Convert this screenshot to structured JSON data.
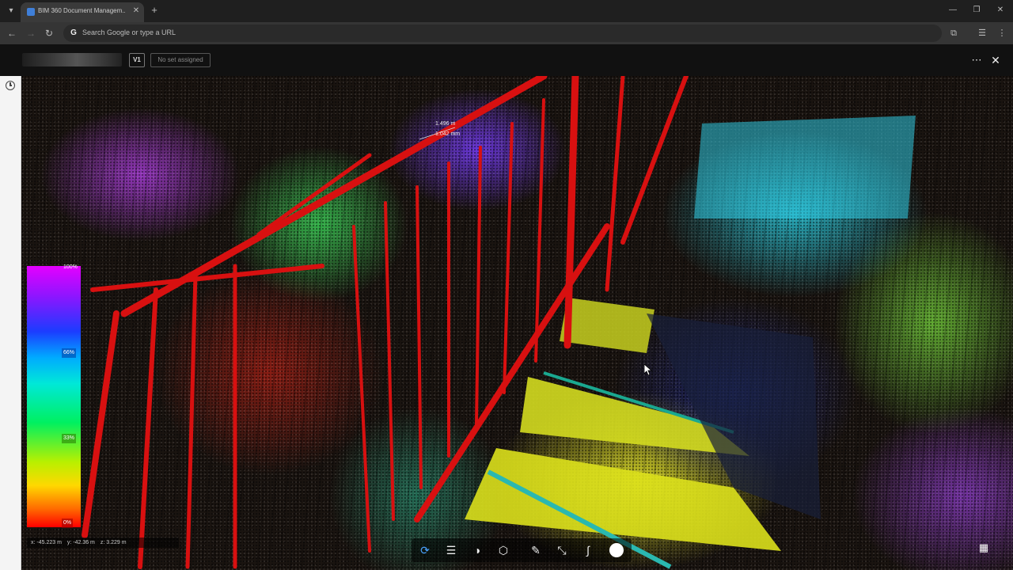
{
  "browser": {
    "tab_title": "BIM 360 Document Managem...",
    "omnibox_placeholder": "Search Google or type a URL",
    "tab_close": "✕",
    "new_tab": "+"
  },
  "viewer": {
    "version_badge": "V1",
    "status": "No set assigned"
  },
  "measurement": {
    "line1": "1.496 m",
    "line2": "1.042 mm"
  },
  "legend": {
    "ticks": [
      "100%",
      "66%",
      "33%",
      "0%"
    ]
  },
  "coordinates": {
    "x": "x: -45.223 m",
    "y": "y: -42.36 m",
    "z": "z: 3.229 m"
  },
  "toolbar": {
    "tools": [
      "orbit-icon",
      "layers-icon",
      "section-icon",
      "cube-icon",
      "markup-icon",
      "measure-icon",
      "path-icon",
      "point-size-dot"
    ]
  },
  "colors": {
    "legend_top": "#e400ff",
    "legend_bottom": "#ff0000",
    "railing": "#d81010",
    "active_tool": "#4aa3ff"
  }
}
